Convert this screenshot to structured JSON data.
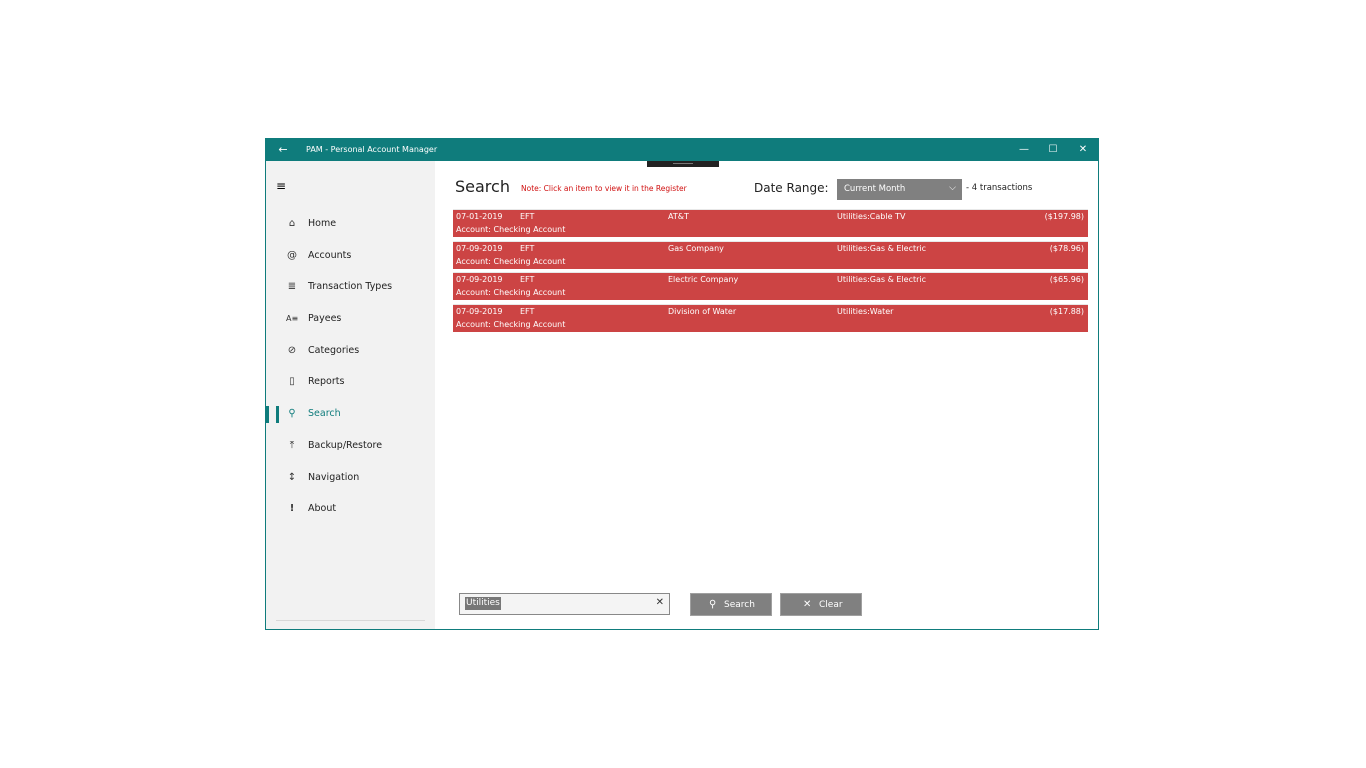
{
  "window": {
    "title": "PAM - Personal Account Manager",
    "back_icon": "←",
    "minimize_icon": "—",
    "maximize_icon": "☐",
    "close_icon": "✕"
  },
  "sidebar": {
    "menu_icon": "≡",
    "items": [
      {
        "label": "Home",
        "icon": "⌂"
      },
      {
        "label": "Accounts",
        "icon": "@"
      },
      {
        "label": "Transaction Types",
        "icon": "≣"
      },
      {
        "label": "Payees",
        "icon": "A≡"
      },
      {
        "label": "Categories",
        "icon": "⊘"
      },
      {
        "label": "Reports",
        "icon": "▯"
      },
      {
        "label": "Search",
        "icon": "⚲"
      },
      {
        "label": "Backup/Restore",
        "icon": "⤒"
      },
      {
        "label": "Navigation",
        "icon": "↕"
      },
      {
        "label": "About",
        "icon": "!"
      }
    ]
  },
  "main": {
    "title": "Search",
    "note": "Note: Click an item to view it in the Register",
    "date_range_label": "Date Range:",
    "date_range_value": "Current Month",
    "date_range_chevron": "⌵",
    "count": "- 4 transactions",
    "transactions": [
      {
        "date": "07-01-2019",
        "type": "EFT",
        "payee": "AT&T",
        "category": "Utilities:Cable TV",
        "amount": "($197.98)",
        "account": "Account:  Checking Account"
      },
      {
        "date": "07-09-2019",
        "type": "EFT",
        "payee": "Gas Company",
        "category": "Utilities:Gas & Electric",
        "amount": "($78.96)",
        "account": "Account:  Checking Account"
      },
      {
        "date": "07-09-2019",
        "type": "EFT",
        "payee": "Electric Company",
        "category": "Utilities:Gas & Electric",
        "amount": "($65.96)",
        "account": "Account:  Checking Account"
      },
      {
        "date": "07-09-2019",
        "type": "EFT",
        "payee": "Division of Water",
        "category": "Utilities:Water",
        "amount": "($17.88)",
        "account": "Account:  Checking Account"
      }
    ],
    "search_value": "Utilities",
    "clear_x": "✕",
    "search_button": {
      "icon": "⚲",
      "label": "Search"
    },
    "clear_button": {
      "icon": "✕",
      "label": "Clear"
    }
  },
  "colors": {
    "accent": "#0f7c7c",
    "row_bg": "#cc4444",
    "note": "#d01010",
    "button": "#808080"
  }
}
